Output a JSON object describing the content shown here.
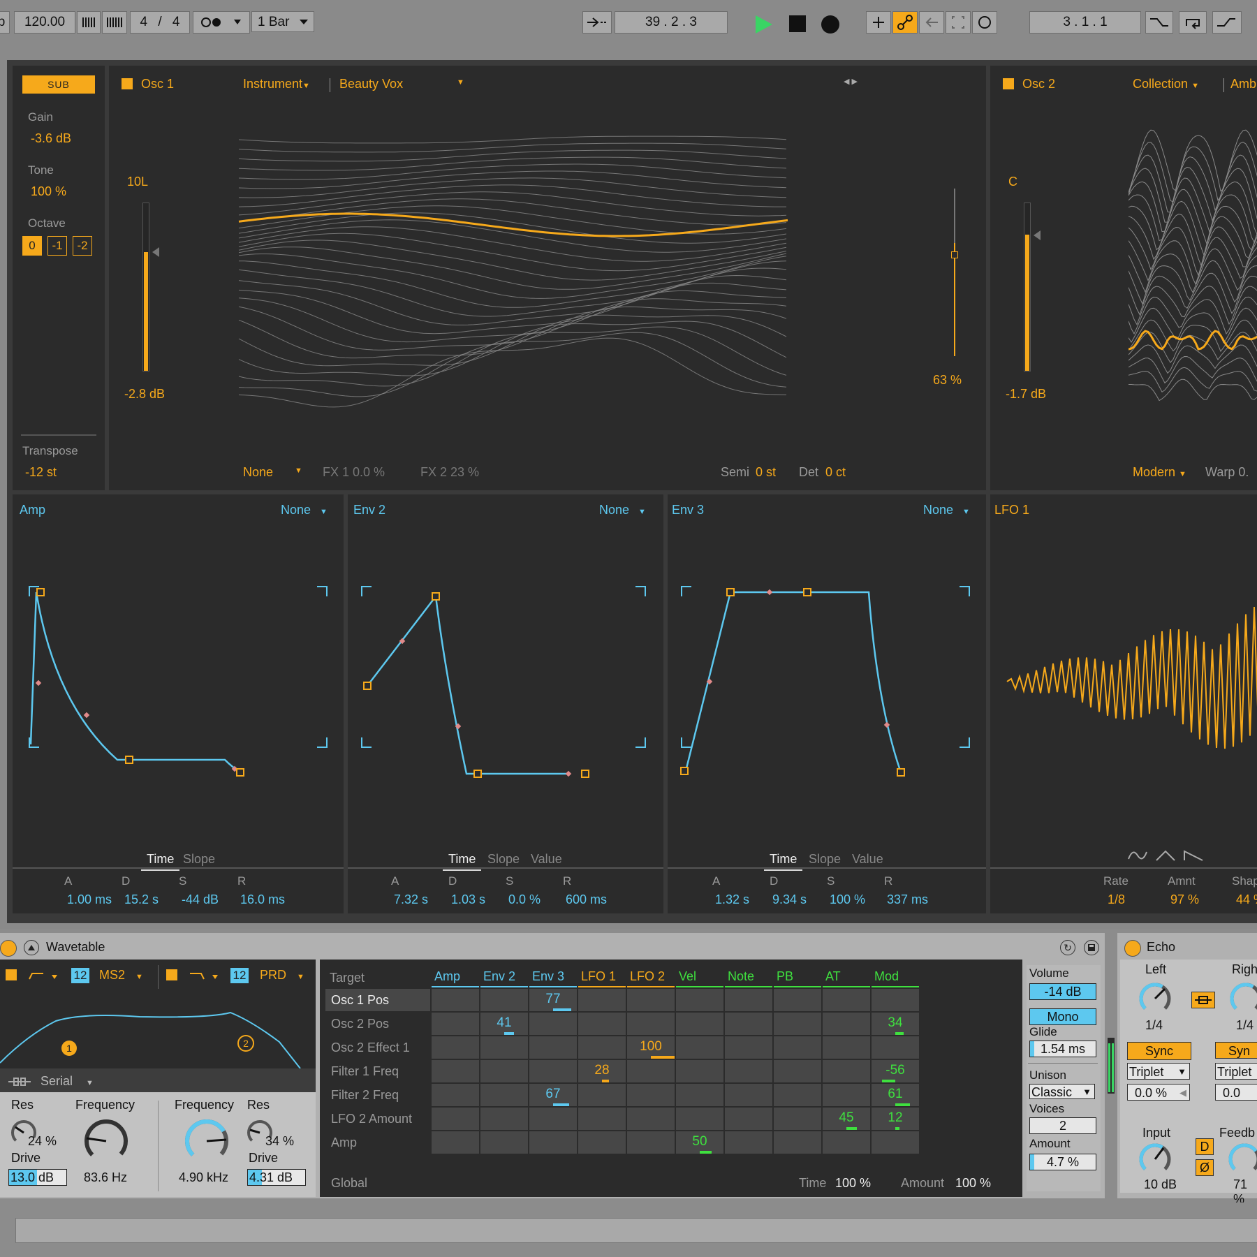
{
  "transport": {
    "b_cut": "b",
    "tempo": "120.00",
    "signature_num": "4",
    "signature_sep": "/",
    "signature_den": "4",
    "quantize": "1 Bar",
    "position": "39 .   2 .   3",
    "loop_position": "3 .   1 .   1"
  },
  "sub": {
    "button": "SUB",
    "gain_label": "Gain",
    "gain_value": "-3.6 dB",
    "tone_label": "Tone",
    "tone_value": "100 %",
    "octave_label": "Octave",
    "octaves": [
      "0",
      "-1",
      "-2"
    ],
    "transpose_label": "Transpose",
    "transpose_value": "-12 st"
  },
  "osc1": {
    "title": "Osc 1",
    "category": "Instrument",
    "wavetable": "Beauty Vox",
    "pan": "10L",
    "gain": "-2.8 dB",
    "position": "63 %",
    "fx_mode": "None",
    "fx1": "FX 1 0.0 %",
    "fx2": "FX 2 23 %",
    "semi_label": "Semi",
    "semi_value": "0 st",
    "det_label": "Det",
    "det_value": "0 ct"
  },
  "osc2": {
    "title": "Osc 2",
    "category": "Collection",
    "wavetable": "Amb",
    "pan": "C",
    "gain": "-1.7 dB",
    "fx_mode": "Modern",
    "warp": "Warp 0."
  },
  "envelopes": [
    {
      "title": "Amp",
      "mode": "None",
      "tabs": [
        "Time",
        "Slope"
      ],
      "params": [
        "A",
        "D",
        "S",
        "R"
      ],
      "values": [
        "1.00 ms",
        "15.2 s",
        "-44 dB",
        "16.0 ms"
      ]
    },
    {
      "title": "Env 2",
      "mode": "None",
      "tabs": [
        "Time",
        "Slope",
        "Value"
      ],
      "params": [
        "A",
        "D",
        "S",
        "R"
      ],
      "values": [
        "7.32 s",
        "1.03 s",
        "0.0 %",
        "600 ms"
      ]
    },
    {
      "title": "Env 3",
      "mode": "None",
      "tabs": [
        "Time",
        "Slope",
        "Value"
      ],
      "params": [
        "A",
        "D",
        "S",
        "R"
      ],
      "values": [
        "1.32 s",
        "9.34 s",
        "100 %",
        "337 ms"
      ]
    }
  ],
  "lfo1": {
    "title": "LFO 1",
    "rate_label": "Rate",
    "rate_value": "1/8",
    "amnt_label": "Amnt",
    "amnt_value": "97 %",
    "shape_label": "Shap",
    "shape_value": "44 %"
  },
  "device": {
    "name": "Wavetable",
    "filter1_slope": "12",
    "filter1_type": "MS2",
    "filter2_slope": "12",
    "filter2_type": "PRD",
    "routing": "Serial",
    "f1_res_label": "Res",
    "f1_res_value": "24 %",
    "f1_freq_label": "Frequency",
    "f1_freq_value": "83.6 Hz",
    "f1_drive_label": "Drive",
    "f1_drive_value": "13.0 dB",
    "f2_freq_label": "Frequency",
    "f2_freq_value": "4.90 kHz",
    "f2_res_label": "Res",
    "f2_res_value": "34 %",
    "f2_drive_label": "Drive",
    "f2_drive_value": "4.31 dB",
    "marker1": "1",
    "marker2": "2"
  },
  "matrix": {
    "target_label": "Target",
    "global_label": "Global",
    "time_label": "Time",
    "time_value": "100 %",
    "amount_label": "Amount",
    "amount_value": "100 %",
    "columns": [
      "Amp",
      "Env 2",
      "Env 3",
      "LFO 1",
      "LFO 2",
      "Vel",
      "Note",
      "PB",
      "AT",
      "Mod"
    ],
    "rows": [
      "Osc 1 Pos",
      "Osc 2 Pos",
      "Osc 2 Effect 1",
      "Filter 1 Freq",
      "Filter 2 Freq",
      "LFO 2 Amount",
      "Amp"
    ],
    "cells": [
      {
        "row": 0,
        "col": 2,
        "value": "77"
      },
      {
        "row": 1,
        "col": 1,
        "value": "41"
      },
      {
        "row": 1,
        "col": 9,
        "value": "34"
      },
      {
        "row": 2,
        "col": 4,
        "value": "100"
      },
      {
        "row": 3,
        "col": 3,
        "value": "28"
      },
      {
        "row": 3,
        "col": 9,
        "value": "-56"
      },
      {
        "row": 4,
        "col": 2,
        "value": "67"
      },
      {
        "row": 4,
        "col": 9,
        "value": "61"
      },
      {
        "row": 5,
        "col": 8,
        "value": "45"
      },
      {
        "row": 5,
        "col": 9,
        "value": "12"
      },
      {
        "row": 6,
        "col": 5,
        "value": "50"
      }
    ]
  },
  "global": {
    "volume_label": "Volume",
    "volume_value": "-14 dB",
    "mono": "Mono",
    "glide_label": "Glide",
    "glide_value": "1.54 ms",
    "unison_label": "Unison",
    "unison_value": "Classic",
    "voices_label": "Voices",
    "voices_value": "2",
    "amount_label": "Amount",
    "amount_value": "4.7 %"
  },
  "echo": {
    "name": "Echo",
    "left_label": "Left",
    "left_value": "1/4",
    "right_label": "Righ",
    "right_value": "1/4",
    "sync": "Sync",
    "sync2": "Syn",
    "triplet": "Triplet",
    "offset": "0.0 %",
    "offset2": "0.0",
    "input_label": "Input",
    "input_value": "10 dB",
    "feedback_label": "Feedb",
    "feedback_value": "71 %",
    "d_button": "D",
    "phase_button": "Ø"
  },
  "colors": {
    "orange": "#f6a91b",
    "blue": "#5dc8ef",
    "green": "#3fe03f",
    "panel": "#2b2b2b"
  }
}
